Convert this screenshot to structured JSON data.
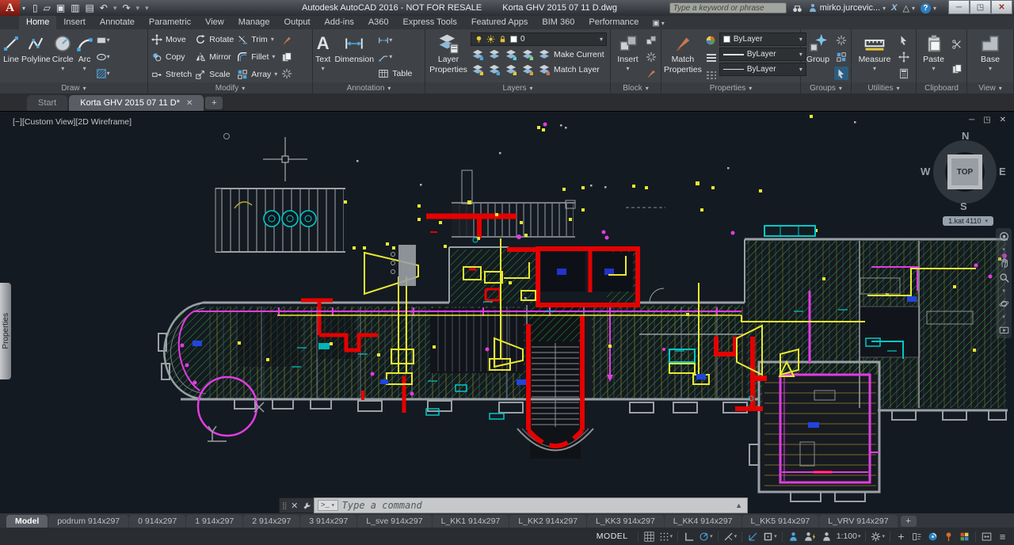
{
  "colors": {
    "accent_blue": "#4da6e0",
    "hatch_green": "#2f9e2f",
    "wall_red": "#e60000",
    "duct_yellow": "#e8e832",
    "pipe_magenta": "#e23ce2",
    "detail_cyan": "#00c8c8"
  },
  "title_bar": {
    "logo_letter": "A",
    "app_title": "Autodesk AutoCAD 2016 - NOT FOR RESALE",
    "doc_title": "Korta GHV 2015 07 11 D.dwg",
    "search_placeholder": "Type a keyword or phrase",
    "user_name": "mirko.jurcevic...",
    "exchange_label": "X",
    "help_label": "?"
  },
  "ribbon": {
    "tabs": [
      {
        "label": "Home"
      },
      {
        "label": "Insert"
      },
      {
        "label": "Annotate"
      },
      {
        "label": "Parametric"
      },
      {
        "label": "View"
      },
      {
        "label": "Manage"
      },
      {
        "label": "Output"
      },
      {
        "label": "Add-ins"
      },
      {
        "label": "A360"
      },
      {
        "label": "Express Tools"
      },
      {
        "label": "Featured Apps"
      },
      {
        "label": "BIM 360"
      },
      {
        "label": "Performance"
      }
    ],
    "draw": {
      "title": "Draw",
      "line": "Line",
      "polyline": "Polyline",
      "circle": "Circle",
      "arc": "Arc"
    },
    "modify": {
      "title": "Modify",
      "move": "Move",
      "rotate": "Rotate",
      "trim": "Trim",
      "copy": "Copy",
      "mirror": "Mirror",
      "fillet": "Fillet",
      "stretch": "Stretch",
      "scale": "Scale",
      "array": "Array"
    },
    "annotation": {
      "title": "Annotation",
      "text": "Text",
      "text_glyph": "A",
      "dimension": "Dimension",
      "table": "Table"
    },
    "layers": {
      "title": "Layers",
      "layer_properties_line1": "Layer",
      "layer_properties_line2": "Properties",
      "current_layer": "0",
      "make_current": "Make Current",
      "match_layer": "Match Layer"
    },
    "block": {
      "title": "Block",
      "insert": "Insert"
    },
    "properties": {
      "title": "Properties",
      "match_line1": "Match",
      "match_line2": "Properties",
      "object_color": "ByLayer",
      "lineweight": "ByLayer",
      "linetype": "ByLayer"
    },
    "groups": {
      "title": "Groups",
      "group": "Group"
    },
    "utilities": {
      "title": "Utilities",
      "measure": "Measure"
    },
    "clipboard": {
      "title": "Clipboard",
      "paste": "Paste"
    },
    "view": {
      "title": "View",
      "base": "Base"
    }
  },
  "file_tabs": {
    "start": "Start",
    "drawing": "Korta GHV 2015 07 11 D*"
  },
  "viewport": {
    "controls": "[−][Custom View][2D Wireframe]"
  },
  "viewcube": {
    "n": "N",
    "s": "S",
    "e": "E",
    "w": "W",
    "top": "TOP",
    "level": "1.kat 4110"
  },
  "command": {
    "placeholder": "Type a command"
  },
  "layout_tabs": {
    "tabs": [
      {
        "label": "Model"
      },
      {
        "label": "podrum 914x297"
      },
      {
        "label": "0 914x297"
      },
      {
        "label": "1 914x297"
      },
      {
        "label": "2 914x297"
      },
      {
        "label": "3 914x297"
      },
      {
        "label": "L_sve 914x297"
      },
      {
        "label": "L_KK1 914x297"
      },
      {
        "label": "L_KK2 914x297"
      },
      {
        "label": "L_KK3 914x297"
      },
      {
        "label": "L_KK4 914x297"
      },
      {
        "label": "L_KK5 914x297"
      },
      {
        "label": "L_VRV 914x297"
      }
    ]
  },
  "status_bar": {
    "model": "MODEL",
    "scale": "1:100"
  }
}
